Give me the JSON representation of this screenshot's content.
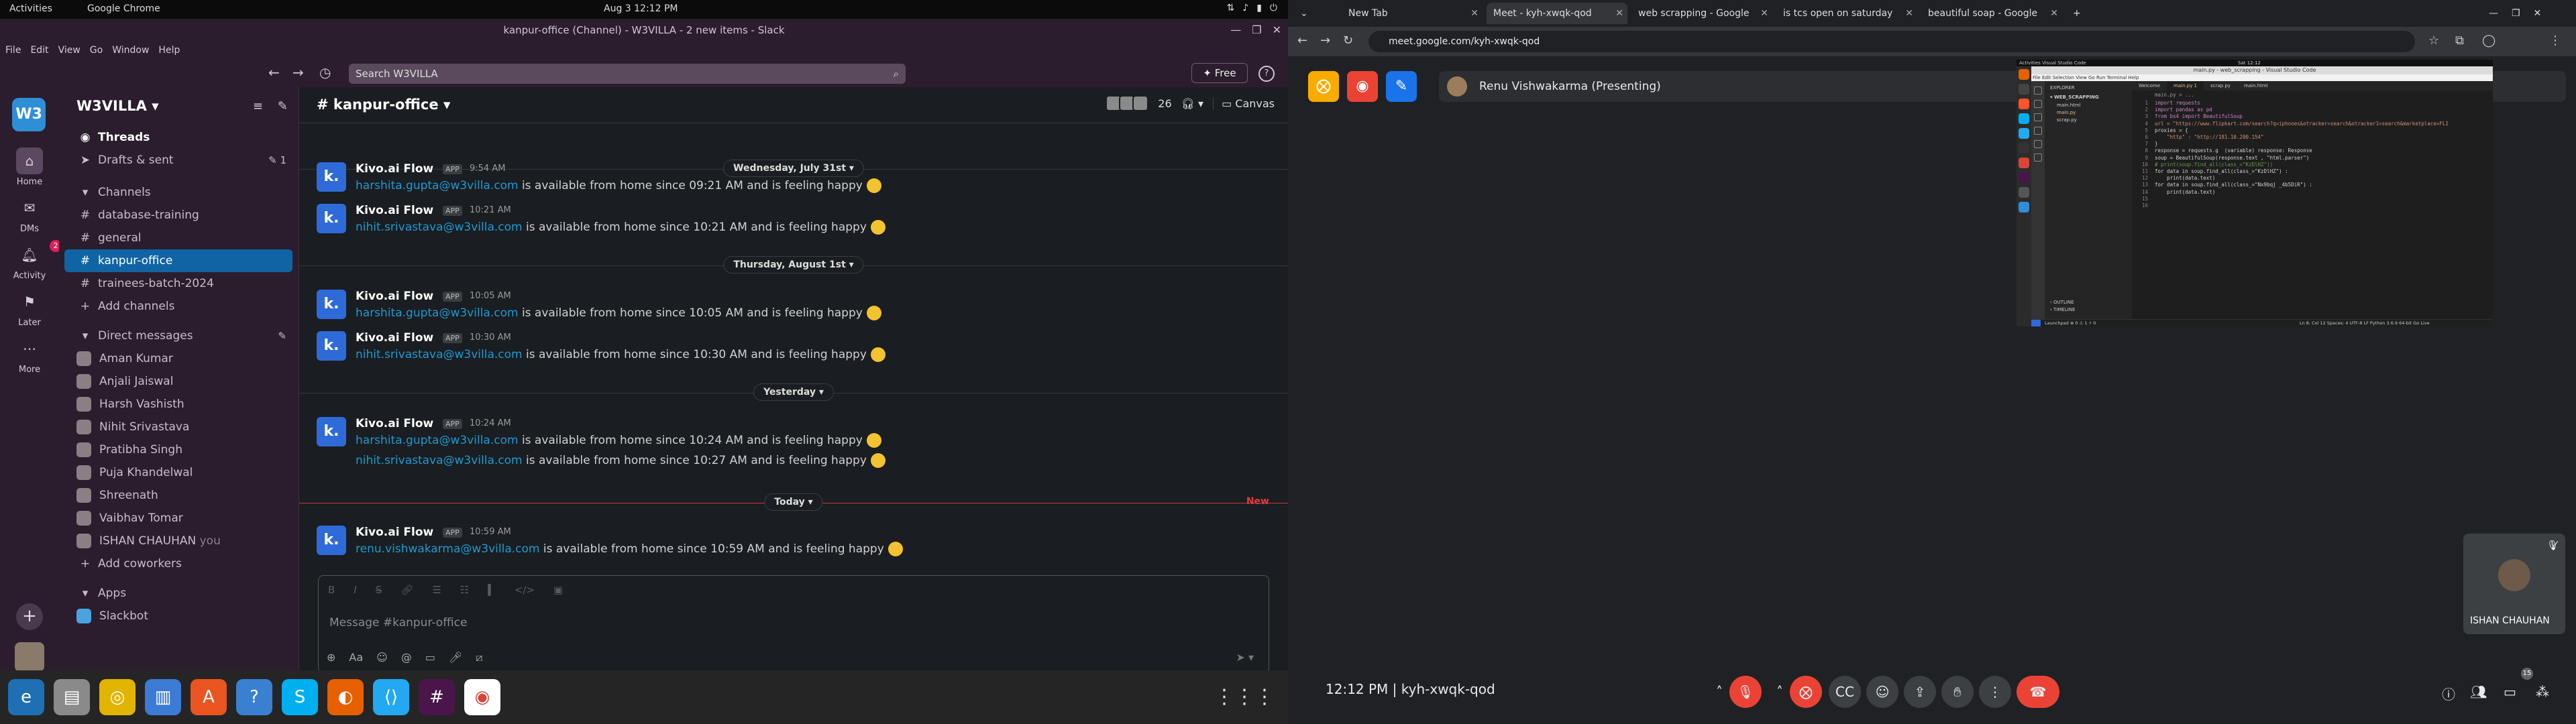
{
  "system": {
    "activities": "Activities",
    "app_name": "Google Chrome",
    "clock": "Aug 3  12:12 PM",
    "dock_icons": [
      "edge-icon",
      "files-icon",
      "rhythmbox-icon",
      "writer-icon",
      "software-icon",
      "help-icon",
      "skype-icon",
      "firefox-icon",
      "vscode-icon",
      "slack-icon",
      "chrome-icon"
    ]
  },
  "slack": {
    "window_title": "kanpur-office (Channel) - W3VILLA - 2 new items - Slack",
    "menu": [
      "File",
      "Edit",
      "View",
      "Go",
      "Window",
      "Help"
    ],
    "search_placeholder": "Search W3VILLA",
    "free_label": "Free",
    "workspace_initial": "W3",
    "workspace_name": "W3VILLA",
    "rail": [
      {
        "label": "Home",
        "icon": "home-icon"
      },
      {
        "label": "DMs",
        "icon": "dm-icon"
      },
      {
        "label": "Activity",
        "icon": "bell-icon",
        "badge": "2"
      },
      {
        "label": "Later",
        "icon": "bookmark-icon"
      },
      {
        "label": "More",
        "icon": "more-icon"
      }
    ],
    "threads": "Threads",
    "drafts": "Drafts & sent",
    "drafts_count": "1",
    "channels_header": "Channels",
    "channels": [
      "database-training",
      "general",
      "kanpur-office",
      "trainees-batch-2024"
    ],
    "add_channels": "Add channels",
    "dm_header": "Direct messages",
    "dms": [
      "Aman Kumar",
      "Anjali Jaiswal",
      "Harsh Vashisth",
      "Nihit Srivastava",
      "Pratibha Singh",
      "Puja Khandelwal",
      "Shreenath",
      "Vaibhav Tomar",
      "ISHAN CHAUHAN"
    ],
    "dm_you": "you",
    "add_coworkers": "Add coworkers",
    "apps_header": "Apps",
    "apps": [
      "Slackbot"
    ],
    "channel_title": "# kanpur-office",
    "member_count": "26",
    "canvas_label": "Canvas",
    "app_badge": "APP",
    "sender": "Kivo.ai Flow",
    "day_labels": [
      "Wednesday, July 31st",
      "Thursday, August 1st",
      "Yesterday",
      "Today"
    ],
    "new_label": "New",
    "messages": [
      {
        "time": "9:54 AM",
        "lines": [
          {
            "link": "harshita.gupta@w3villa.com",
            "text": " is available from home since 09:21 AM and is feeling happy"
          }
        ]
      },
      {
        "time": "10:21 AM",
        "lines": [
          {
            "link": "nihit.srivastava@w3villa.com",
            "text": " is available from home since 10:21 AM and is feeling happy"
          }
        ]
      },
      {
        "time": "10:05 AM",
        "lines": [
          {
            "link": "harshita.gupta@w3villa.com",
            "text": " is available from home since 10:05 AM and is feeling happy"
          }
        ]
      },
      {
        "time": "10:30 AM",
        "lines": [
          {
            "link": "nihit.srivastava@w3villa.com",
            "text": " is available from home since 10:30 AM and is feeling happy"
          }
        ]
      },
      {
        "time": "10:24 AM",
        "lines": [
          {
            "link": "harshita.gupta@w3villa.com",
            "text": " is available from home since 10:24 AM and is feeling happy"
          },
          {
            "link": "nihit.srivastava@w3villa.com",
            "text": " is available from home since 10:27 AM and is feeling happy"
          }
        ]
      },
      {
        "time": "10:59 AM",
        "lines": [
          {
            "link": "renu.vishwakarma@w3villa.com",
            "text": " is available from home since 10:59 AM and is feeling happy"
          }
        ]
      }
    ],
    "composer_placeholder": "Message #kanpur-office"
  },
  "chrome": {
    "tabs": [
      "New Tab",
      "Meet - kyh-xwqk-qod",
      "web scrapping - Google",
      "is tcs open on saturday",
      "beautiful soap - Google"
    ],
    "url": "meet.google.com/kyh-xwqk-qod"
  },
  "meet": {
    "presenter": "Renu Vishwakarma (Presenting)",
    "self_name": "ISHAN CHAUHAN",
    "time": "12:12 PM",
    "code": "kyh-xwqk-qod",
    "participant_badge": "15"
  },
  "vscode": {
    "topbar": "Activities    Visual Studio Code",
    "clock": "Sat 12:12",
    "title": "main.py - web_scrapping - Visual Studio Code",
    "menu": "File  Edit  Selection  View  Go  Run  Terminal  Help",
    "explorer": "EXPLORER",
    "folder": "WEB_SCRAPPING",
    "files": [
      "main.html",
      "main.py",
      "scrap.py"
    ],
    "tabs": [
      "Welcome",
      "main.py 1",
      "scrap.py",
      "main.html"
    ],
    "breadcrumb": "main.py > ...",
    "code_lines": [
      "import requests",
      "import pandas as pd",
      "from bs4 import BeautifulSoup",
      "url = \"https://www.flipkart.com/search?q=iphones&otracker=search&otracker1=search&marketplace=FLI",
      "proxies = {",
      "    \"http\" : \"http://181.10.200.154\"",
      "}",
      "response = requests.g  (variable) response: Response",
      "soup = BeautifulSoup(response.text , \"html.parser\")",
      "# print(soup.find_all(class_=\"KzDlHZ\"))",
      "for data in soup.find_all(class_=\"KzDlHZ\") :",
      "    print(data.text)",
      "for data in soup.find_all(class_=\"Nx9bqj _4b5DiR\") :",
      "    print(data.text)",
      "",
      ""
    ],
    "outline": "OUTLINE",
    "timeline": "TIMELINE",
    "status_left": "Launchpad   ⊗ 0 ⚠ 1   ⚡ 0",
    "status_right": "Ln 8, Col 12   Spaces: 4   UTF-8   LF   Python   3.6.9 64-bit   Go Live"
  }
}
